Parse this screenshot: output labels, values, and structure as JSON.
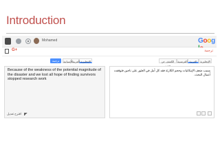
{
  "slide": {
    "title": "Introduction"
  },
  "browser": {
    "user_name": "Mohamed"
  },
  "google": {
    "letters": [
      {
        "ch": "G",
        "color": "#4285F4"
      },
      {
        "ch": "o",
        "color": "#EA4335"
      },
      {
        "ch": "o",
        "color": "#FBBC05"
      },
      {
        "ch": "g",
        "color": "#4285F4"
      },
      {
        "ch": "l",
        "color": "#34A853"
      },
      {
        "ch": "e",
        "color": "#EA4335"
      }
    ],
    "gplus": "G+",
    "translate_label": "ترجمة"
  },
  "toolbar": {
    "translate_button": "ترجمة",
    "target_tabs": [
      "الإنجليزية",
      "العربية",
      "الإسبانية"
    ],
    "source_tabs": [
      "الإنجليزية",
      "العربية",
      "الفرنسية",
      "الكشف عن اللغة"
    ]
  },
  "output_pane": {
    "text": "Because of the weakness of the potential magnitude of the disaster and we lost all hope of finding survivors stopped research work",
    "suggest_label": "اقترح تعديل"
  },
  "input_pane": {
    "text": "بسبب ضعف الإمكانيات وحجم الكارثة فقد كل أمل في العثور على ناجين فتوقفت أعمال البحث."
  },
  "colors": {
    "accent_blue": "#4d90fe",
    "title_red": "#c0504d"
  }
}
